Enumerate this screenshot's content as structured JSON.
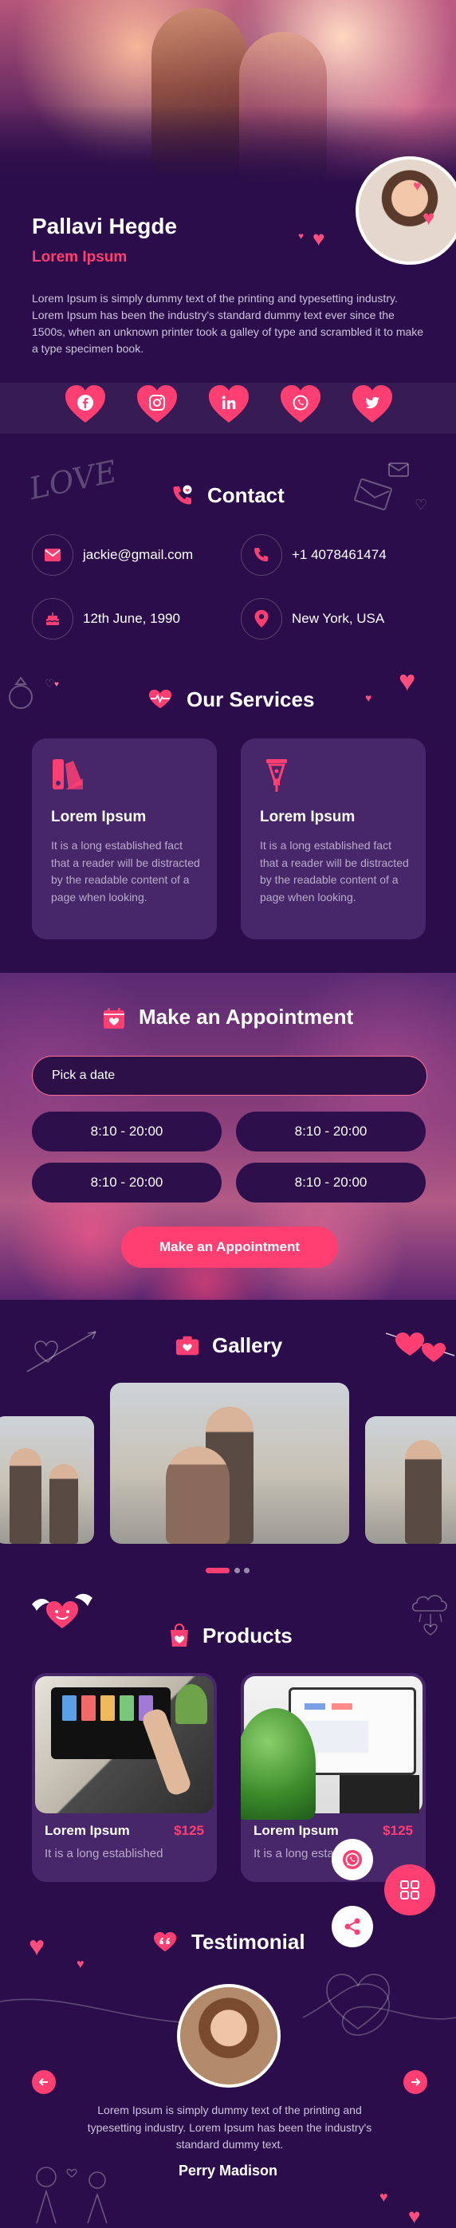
{
  "profile": {
    "name": "Pallavi Hegde",
    "tagline": "Lorem Ipsum",
    "bio": "Lorem Ipsum is simply dummy text of the printing and typesetting industry. Lorem Ipsum has been the industry's standard dummy text ever since the 1500s, when an unknown printer took a galley of type and scrambled it to make a type specimen book."
  },
  "social": [
    {
      "icon": "facebook-icon"
    },
    {
      "icon": "instagram-icon"
    },
    {
      "icon": "linkedin-icon"
    },
    {
      "icon": "whatsapp-icon"
    },
    {
      "icon": "twitter-icon"
    }
  ],
  "contact": {
    "title": "Contact",
    "email": "jackie@gmail.com",
    "phone": "+1 4078461474",
    "birthday": "12th June, 1990",
    "location": "New York, USA"
  },
  "services": {
    "title": "Our Services",
    "items": [
      {
        "title": "Lorem Ipsum",
        "text": "It is a long established fact that a reader will be distracted by the readable content of a page when looking."
      },
      {
        "title": "Lorem Ipsum",
        "text": "It is a long established fact that a reader will be distracted by the readable content of a page when looking."
      }
    ]
  },
  "appointment": {
    "title": "Make an Appointment",
    "date_placeholder": "Pick a date",
    "slots": [
      "8:10 - 20:00",
      "8:10 - 20:00",
      "8:10 - 20:00",
      "8:10 - 20:00"
    ],
    "button": "Make an Appointment"
  },
  "gallery": {
    "title": "Gallery",
    "active_slide": 1,
    "slide_count": 3
  },
  "products": {
    "title": "Products",
    "items": [
      {
        "name": "Lorem Ipsum",
        "price": "$125",
        "desc": "It is a long established"
      },
      {
        "name": "Lorem Ipsum",
        "price": "$125",
        "desc": "It is a long established"
      }
    ]
  },
  "testimonial": {
    "title": "Testimonial",
    "text": "Lorem Ipsum is simply dummy text of the printing and typesetting industry. Lorem Ipsum has been the industry's standard dummy text.",
    "author": "Perry Madison"
  },
  "colors": {
    "background": "#2a0d4a",
    "card": "#47266a",
    "accent": "#ff3f72"
  }
}
